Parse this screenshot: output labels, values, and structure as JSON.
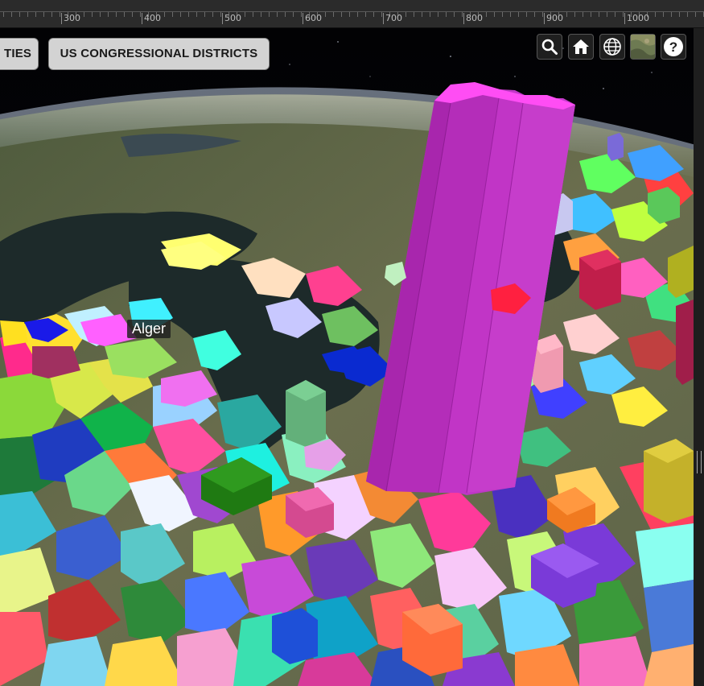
{
  "ruler": {
    "ticks": [
      "300",
      "400",
      "500",
      "600",
      "700",
      "800",
      "900",
      "1000"
    ]
  },
  "layer_buttons": {
    "cities_label": "TIES",
    "districts_label": "US CONGRESSIONAL DISTRICTS"
  },
  "toolbar": {
    "search": "search-icon",
    "home": "home-icon",
    "globe": "globe-icon",
    "basemap": "basemap-icon",
    "help": "help-icon",
    "help_glyph": "?"
  },
  "map": {
    "label": "Alger"
  },
  "colors": {
    "tall_column": "#c23cc8",
    "ruler_bg": "#2b2b2b",
    "button_bg": "#d3d3d3"
  }
}
